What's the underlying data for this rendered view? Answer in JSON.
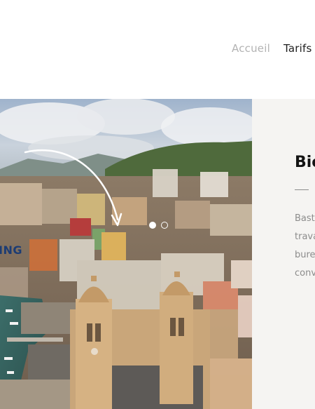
{
  "nav": {
    "items": [
      {
        "label": "Accueil",
        "state": "inactive"
      },
      {
        "label": "Tarifs",
        "state": "active"
      }
    ]
  },
  "hero": {
    "image": "aerial-photo-harbour-town",
    "overlay_label": "ING",
    "slider": {
      "slide_count": 2,
      "active_index": 0
    }
  },
  "panel": {
    "title": "Bie",
    "text_lines": [
      "Bast",
      "trava",
      "bure",
      "conv"
    ]
  },
  "colors": {
    "nav_inactive": "#b3b3b3",
    "nav_active": "#1f1f1f",
    "overlay_label": "#1c3c74",
    "panel_bg": "#f5f4f2",
    "panel_text": "#8c8c8c"
  }
}
